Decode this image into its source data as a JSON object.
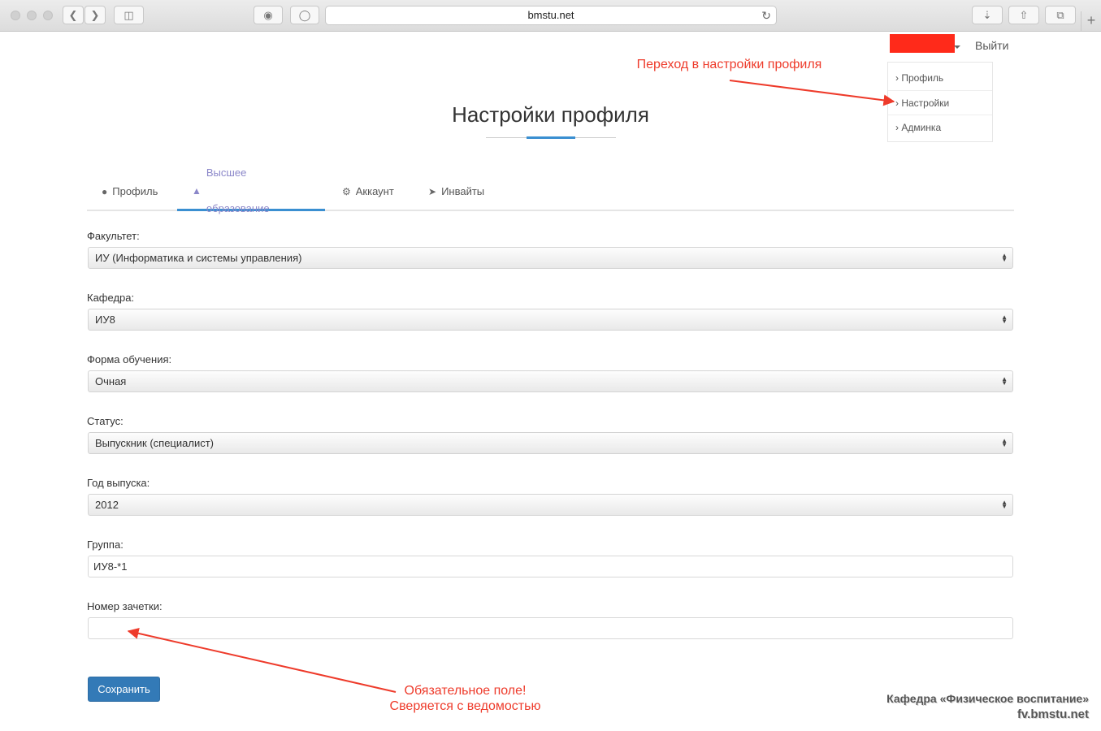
{
  "browser": {
    "url": "bmstu.net",
    "icons": [
      "back-icon",
      "forward-icon",
      "sidebar-icon",
      "ghost-icon",
      "shield-icon",
      "reload-icon",
      "download-icon",
      "share-icon",
      "tabs-icon",
      "plus-icon"
    ]
  },
  "header": {
    "logout": "Выйти",
    "menu": [
      "Профиль",
      "Настройки",
      "Админка"
    ],
    "user_box_color": "#ff2a1a"
  },
  "annotations": {
    "top": "Переход в настройки профиля",
    "bottom_line1": "Обязательное поле!",
    "bottom_line2": "Сверяется с ведомостью",
    "color": "#ee3b2b"
  },
  "page": {
    "title": "Настройки профиля",
    "accent_color": "#3a8fd1"
  },
  "tabs": [
    {
      "label": "Профиль",
      "icon": "user-icon"
    },
    {
      "label": "Высшее образование",
      "icon": "graduation-cap-icon",
      "active": true
    },
    {
      "label": "Аккаунт",
      "icon": "cogs-icon"
    },
    {
      "label": "Инвайты",
      "icon": "paper-plane-icon"
    }
  ],
  "form": {
    "faculty": {
      "label": "Факультет:",
      "value": "ИУ (Информатика и системы управления)"
    },
    "department": {
      "label": "Кафедра:",
      "value": "ИУ8"
    },
    "study_form": {
      "label": "Форма обучения:",
      "value": "Очная"
    },
    "status": {
      "label": "Статус:",
      "value": "Выпускник (специалист)"
    },
    "graduation_year": {
      "label": "Год выпуска:",
      "value": "2012"
    },
    "group": {
      "label": "Группа:",
      "value": "ИУ8-*1"
    },
    "record_book": {
      "label": "Номер зачетки:",
      "value": ""
    },
    "save": "Сохранить"
  },
  "watermark": {
    "line1": "Кафедра «Физическое воспитание»",
    "line2": "fv.bmstu.net"
  }
}
